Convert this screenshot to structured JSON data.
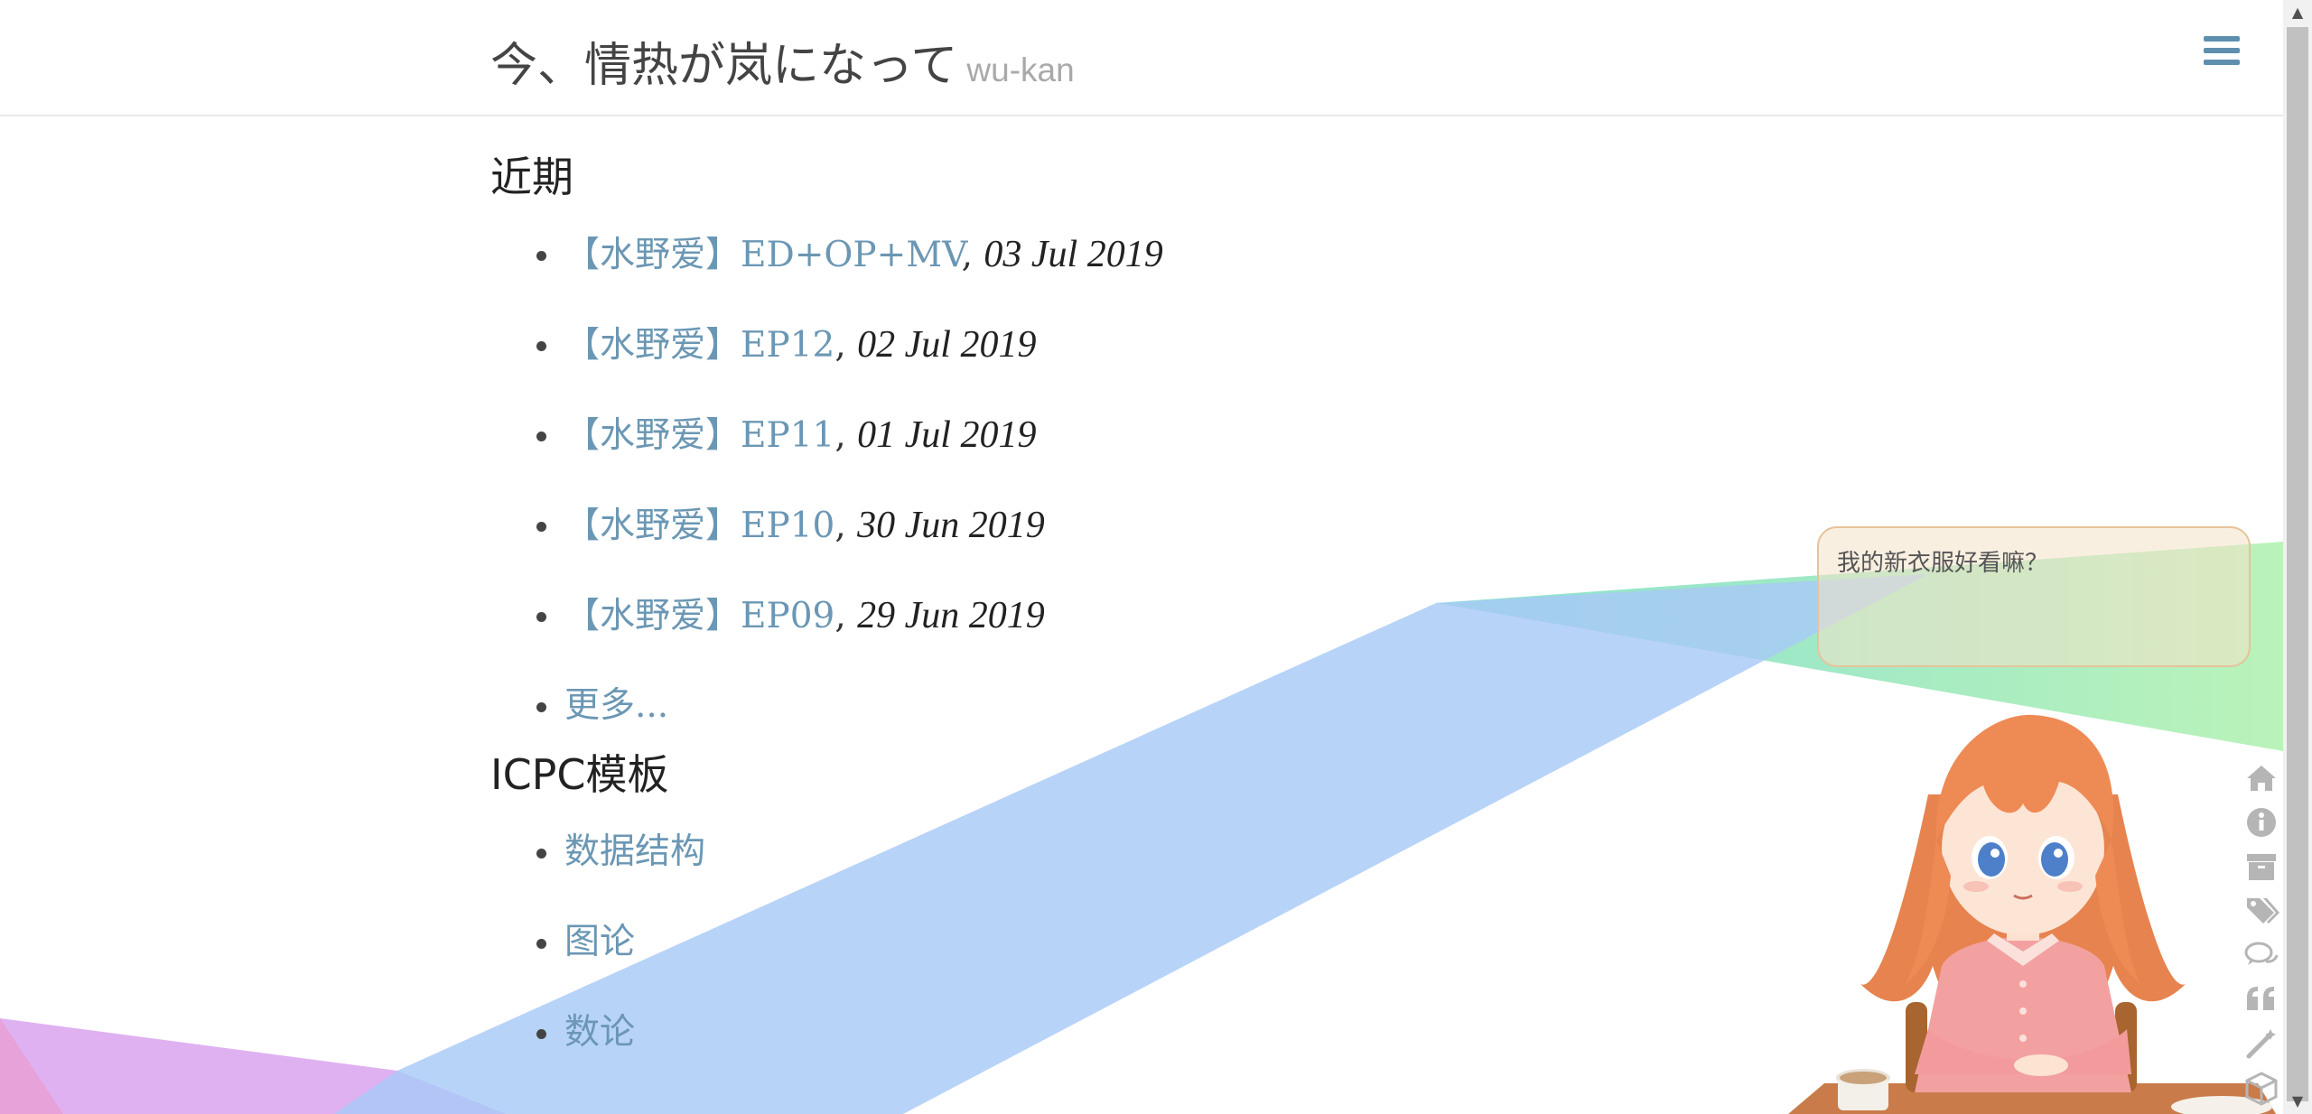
{
  "header": {
    "title": "今、情热が岚になって",
    "subtitle": "wu-kan",
    "menu_icon": "hamburger-menu-icon"
  },
  "recent": {
    "heading": "近期",
    "posts": [
      {
        "title": "【水野爱】ED+OP+MV",
        "sep": ",",
        "date": "03 Jul 2019"
      },
      {
        "title": "【水野爱】EP12",
        "sep": ",",
        "date": "02 Jul 2019"
      },
      {
        "title": "【水野爱】EP11",
        "sep": ",",
        "date": "01 Jul 2019"
      },
      {
        "title": "【水野爱】EP10",
        "sep": ",",
        "date": "30 Jun 2019"
      },
      {
        "title": "【水野爱】EP09",
        "sep": ",",
        "date": "29 Jun 2019"
      }
    ],
    "more": "更多..."
  },
  "icpc": {
    "heading": "ICPC模板",
    "items": [
      "数据结构",
      "图论",
      "数论"
    ]
  },
  "mascot": {
    "speech": "我的新衣服好看嘛？"
  },
  "side_toolbar": {
    "icons": [
      "home-icon",
      "info-icon",
      "archive-icon",
      "tags-icon",
      "comments-icon",
      "quote-icon",
      "magic-wand-icon",
      "cube-icon"
    ]
  },
  "colors": {
    "link": "#6b97b4",
    "menu": "#5f8fae",
    "ribbon_blue": "#a7c8f7",
    "ribbon_green": "#7fdcc0",
    "ribbon_purple": "#d6a6ee"
  }
}
